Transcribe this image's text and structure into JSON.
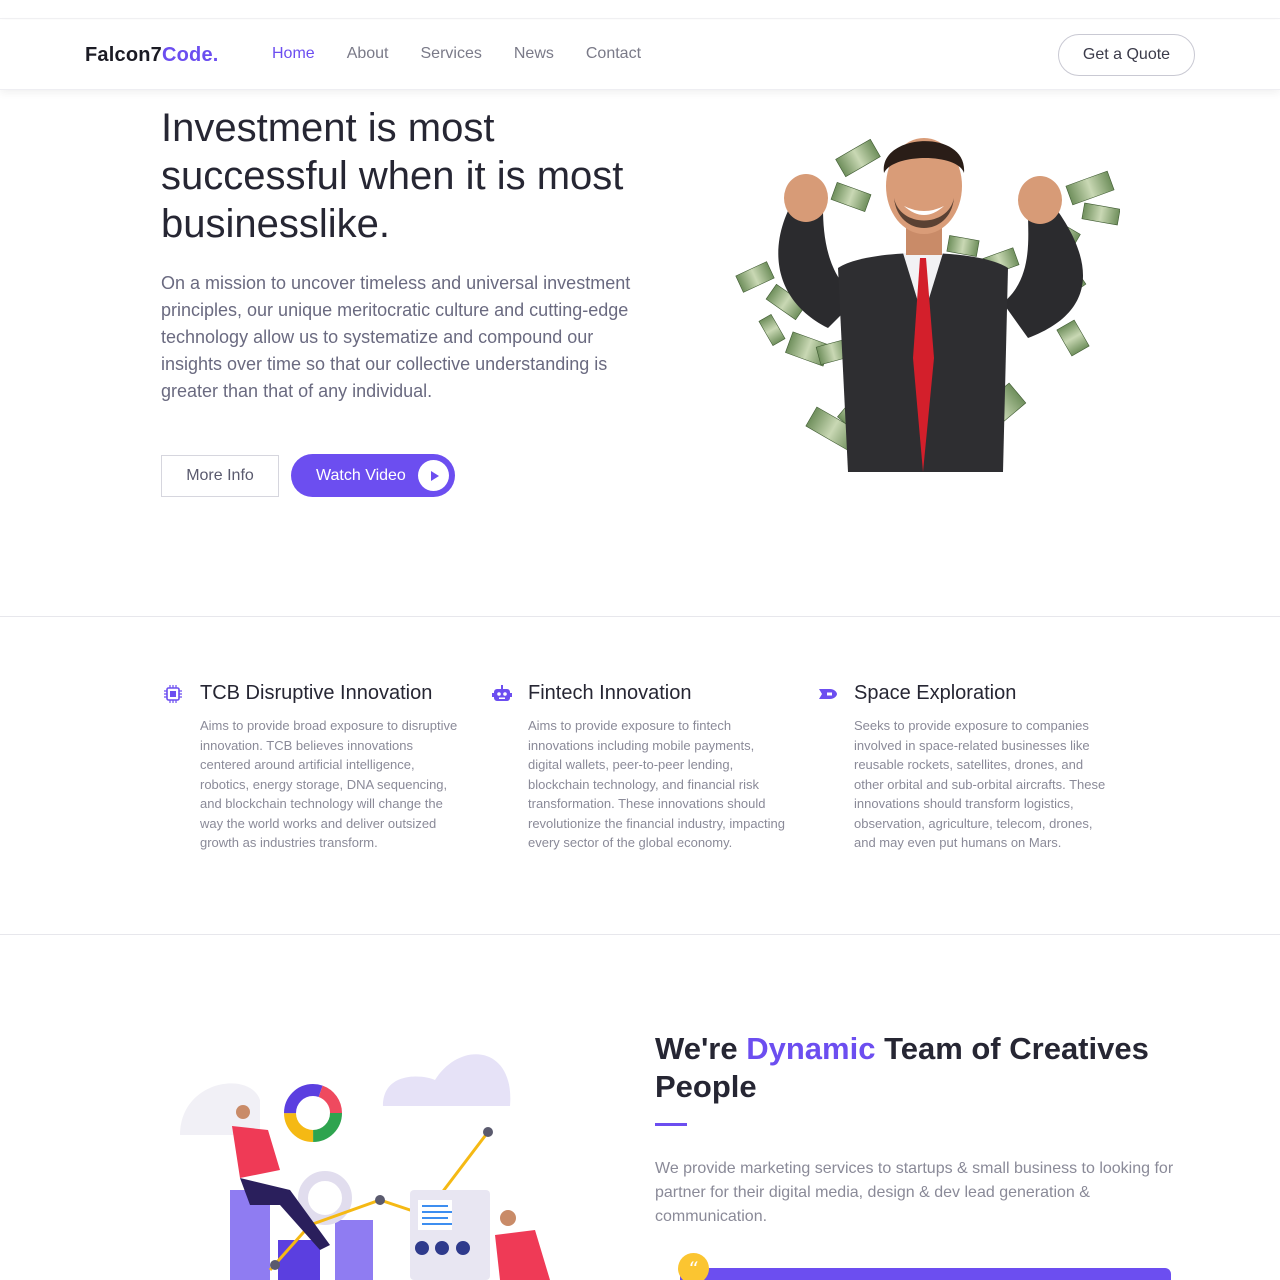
{
  "brand": {
    "name_main": "Falcon7",
    "name_accent": "Code."
  },
  "nav": {
    "items": [
      {
        "label": "Home"
      },
      {
        "label": "About"
      },
      {
        "label": "Services"
      },
      {
        "label": "News"
      },
      {
        "label": "Contact"
      }
    ],
    "cta_label": "Get a Quote"
  },
  "hero": {
    "title": "Investment is most successful when it is most businesslike.",
    "text": "On a mission to uncover timeless and universal investment principles, our unique meritocratic culture and cutting-edge technology allow us to systematize and compound our insights over time so that our collective understanding is greater than that of any individual.",
    "more_info_label": "More Info",
    "watch_video_label": "Watch Video"
  },
  "features": [
    {
      "icon": "cpu-chip-icon",
      "title": "TCB Disruptive Innovation",
      "text": "Aims to provide broad exposure to disruptive innovation. TCB believes innovations centered around artificial intelligence, robotics, energy storage, DNA sequencing, and blockchain technology will change the way the world works and deliver outsized growth as industries transform."
    },
    {
      "icon": "robot-icon",
      "title": "Fintech Innovation",
      "text": "Aims to provide exposure to fintech innovations including mobile payments, digital wallets, peer-to-peer lending, blockchain technology, and financial risk transformation. These innovations should revolutionize the financial industry, impacting every sector of the global economy."
    },
    {
      "icon": "spaceship-icon",
      "title": "Space Exploration",
      "text": "Seeks to provide exposure to companies involved in space-related businesses like reusable rockets, satellites, drones, and other orbital and sub-orbital aircrafts. These innovations should transform logistics, observation, agriculture, telecom, drones, and may even put humans on Mars."
    }
  ],
  "team": {
    "title_pre": "We're ",
    "title_accent": "Dynamic",
    "title_post": " Team of Creatives People",
    "text": "We provide marketing services to startups & small business to looking for partner for their digital media, design & dev lead generation & communication.",
    "quote_mark": "“"
  },
  "colors": {
    "accent": "#6c4ef0",
    "badge": "#fbc531"
  }
}
